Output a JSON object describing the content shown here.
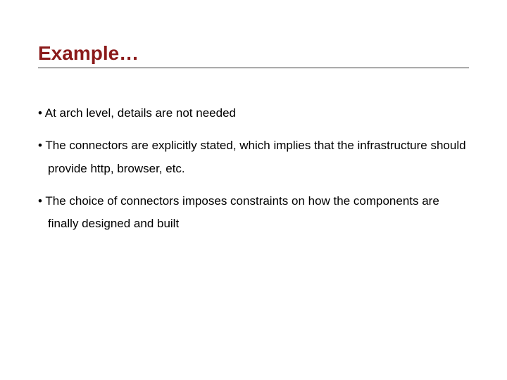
{
  "slide": {
    "title": "Example…",
    "bullets": [
      "At arch level, details are not needed",
      "The connectors are explicitly stated, which implies that the infrastructure should provide http, browser, etc.",
      "The choice of connectors imposes constraints on how the components are finally designed and built"
    ]
  }
}
